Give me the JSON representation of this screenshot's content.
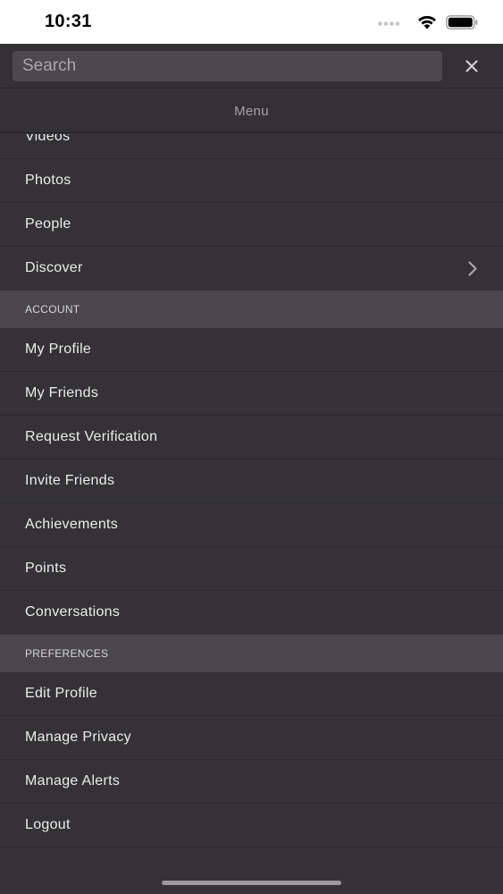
{
  "status": {
    "time": "10:31"
  },
  "search": {
    "placeholder": "Search"
  },
  "header": {
    "title": "Menu"
  },
  "menu_top": [
    {
      "label": "Videos"
    },
    {
      "label": "Photos"
    },
    {
      "label": "People"
    },
    {
      "label": "Discover"
    }
  ],
  "sections": {
    "account": {
      "title": "ACCOUNT",
      "items": [
        {
          "label": "My Profile"
        },
        {
          "label": "My Friends"
        },
        {
          "label": "Request Verification"
        },
        {
          "label": "Invite Friends"
        },
        {
          "label": "Achievements"
        },
        {
          "label": "Points"
        },
        {
          "label": "Conversations"
        }
      ]
    },
    "preferences": {
      "title": "PREFERENCES",
      "items": [
        {
          "label": "Edit Profile"
        },
        {
          "label": "Manage Privacy"
        },
        {
          "label": "Manage Alerts"
        },
        {
          "label": "Logout"
        }
      ]
    }
  },
  "icons": {
    "close": "close-icon",
    "chevron": "chevron-right-icon",
    "wifi": "wifi-icon",
    "battery": "battery-icon",
    "signal": "cellular-signal-icon"
  },
  "colors": {
    "background": "#343235",
    "section_header": "#49474a",
    "search_field": "#4b494c",
    "text": "#ececec"
  }
}
